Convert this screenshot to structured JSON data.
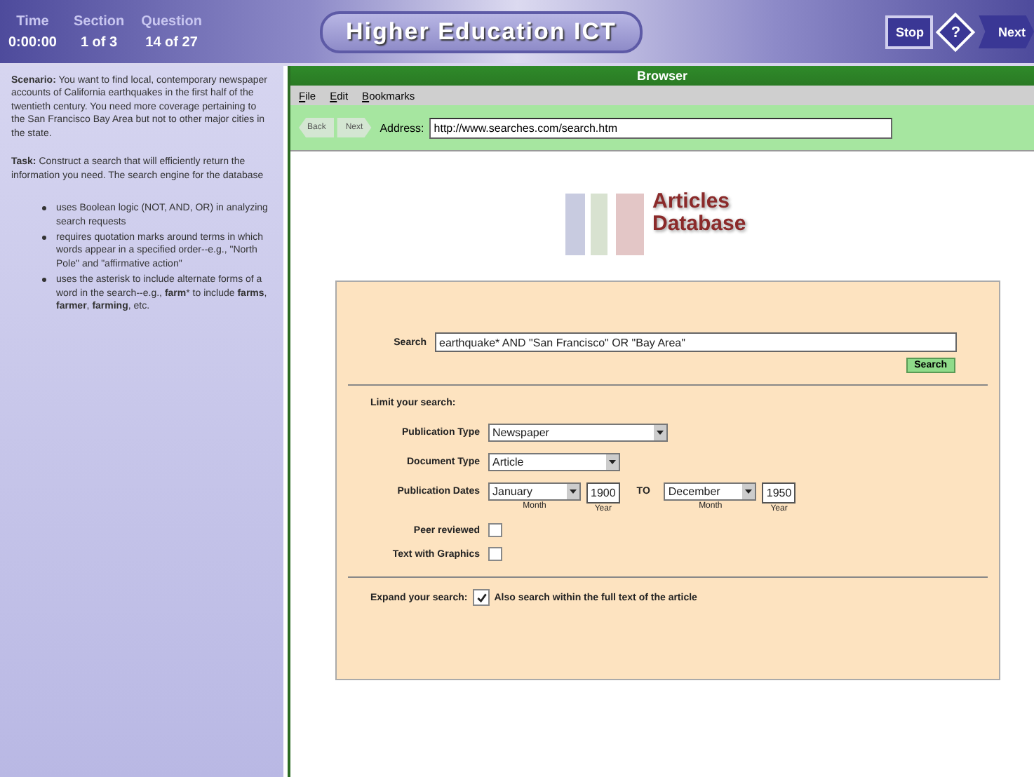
{
  "header": {
    "stats": [
      {
        "label": "Time",
        "value": "0:00:00"
      },
      {
        "label": "Section",
        "value": "1 of 3"
      },
      {
        "label": "Question",
        "value": "14 of 27"
      }
    ],
    "title": "Higher Education ICT",
    "stop": "Stop",
    "help": "?",
    "next": "Next"
  },
  "sidebar": {
    "scenario_label": "Scenario:",
    "scenario": "You want to find local, contemporary newspaper accounts of California earthquakes in the first half of the twentieth century. You need more coverage pertaining to the San Francisco Bay Area but not to other major cities in the state.",
    "task_label": "Task:",
    "task": "Construct a search that will efficiently return the information you need. The search engine for the database",
    "bullets": [
      "uses Boolean logic (NOT, AND, OR) in analyzing search requests",
      "requires quotation marks around terms in which words appear in a specified order--e.g., \"North Pole\" and \"affirmative action\"",
      "uses the asterisk to include alternate forms of a word in the search--e.g., **farm*** to include **farms**, **farmer**, **farming**, etc."
    ]
  },
  "browser": {
    "title": "Browser",
    "menu": [
      "File",
      "Edit",
      "Bookmarks"
    ],
    "back": "Back",
    "next": "Next",
    "address_label": "Address:",
    "address": "http://www.searches.com/search.htm"
  },
  "logo": {
    "line1": "Articles",
    "line2": "Database"
  },
  "form": {
    "search_label": "Search",
    "search_value": "earthquake* AND  \"San Francisco\" OR \"Bay Area\"",
    "search_button": "Search",
    "limit_heading": "Limit your search:",
    "publication_type": {
      "label": "Publication Type",
      "value": "Newspaper"
    },
    "document_type": {
      "label": "Document Type",
      "value": "Article"
    },
    "dates": {
      "label": "Publication Dates",
      "from_month": "January",
      "from_month_caption": "Month",
      "from_year": "1900",
      "from_year_caption": "Year",
      "to_label": "TO",
      "to_month": "December",
      "to_month_caption": "Month",
      "to_year": "1950",
      "to_year_caption": "Year"
    },
    "checkboxes": [
      {
        "label": "Peer reviewed",
        "checked": false
      },
      {
        "label": "Text with Graphics",
        "checked": false
      }
    ],
    "expand": {
      "label": "Expand your search:",
      "option": "Also search within the full text of the article",
      "checked": true
    }
  }
}
